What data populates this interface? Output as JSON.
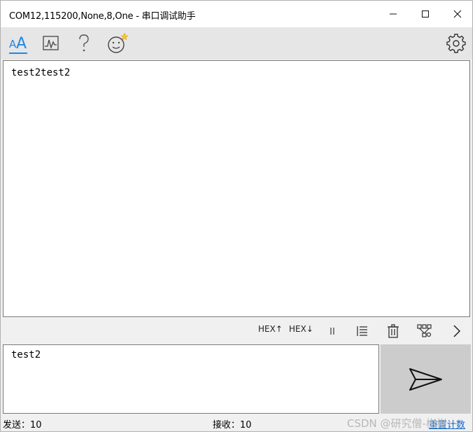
{
  "window": {
    "title": "COM12,115200,None,8,One - 串口调试助手",
    "controls": [
      "minimize-icon",
      "maximize-icon",
      "close-icon"
    ]
  },
  "toolbar": {
    "icons": [
      "font-icon",
      "chart-icon",
      "help-icon",
      "emoji-icon",
      "gear-icon"
    ],
    "accent_color": "#1e88e5"
  },
  "receive": {
    "text": "test2test2"
  },
  "midbar": {
    "hex_send_label": "HEX↑",
    "hex_recv_label": "HEX↓",
    "icons": [
      "pause-icon",
      "list-icon",
      "trash-icon",
      "network-icon",
      "chevron-right-icon"
    ]
  },
  "send": {
    "text": "test2",
    "button_icon": "send-arrow-icon"
  },
  "status": {
    "sent_label": "发送：10",
    "recv_label": "接收：10",
    "reset_label": "重置计数"
  },
  "watermark": {
    "text": "CSDN @研究僧-彬彬"
  }
}
